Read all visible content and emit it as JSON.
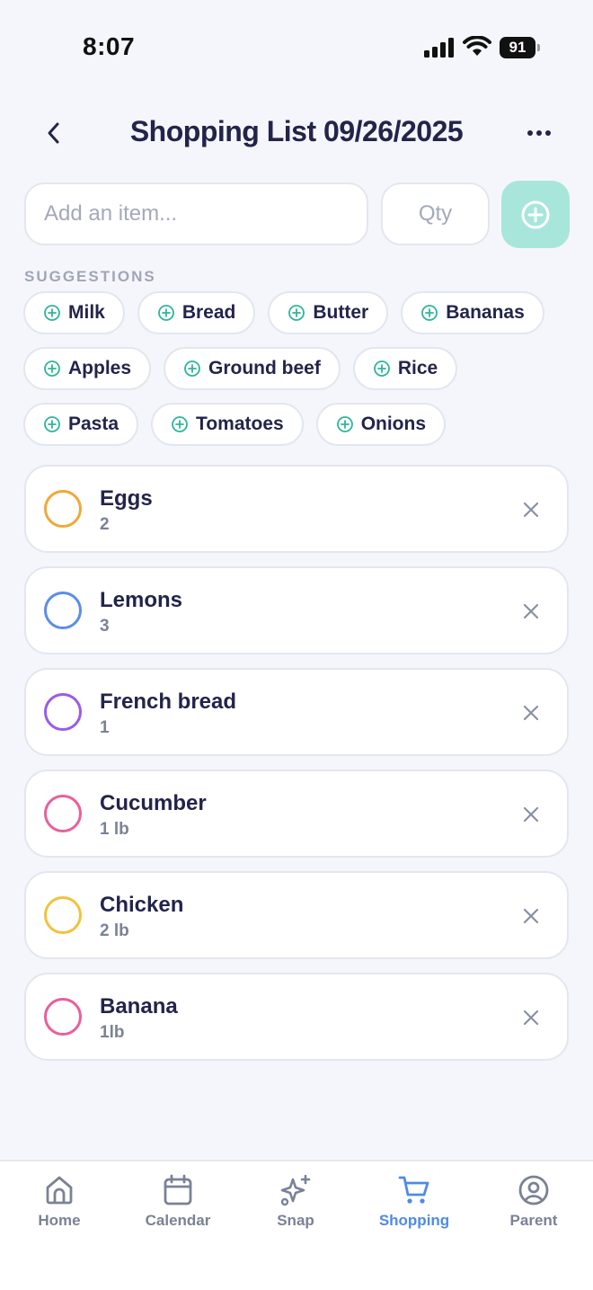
{
  "status_bar": {
    "time": "8:07",
    "battery": "91"
  },
  "header": {
    "title": "Shopping List 09/26/2025",
    "back_icon": "chevron-left-icon",
    "more_icon": "more-horizontal-icon"
  },
  "add_item": {
    "item_placeholder": "Add an item...",
    "qty_placeholder": "Qty",
    "add_icon": "plus-circle-icon"
  },
  "suggestions": {
    "label": "SUGGESTIONS",
    "items": [
      "Milk",
      "Bread",
      "Butter",
      "Bananas",
      "Apples",
      "Ground beef",
      "Rice",
      "Pasta",
      "Tomatoes",
      "Onions"
    ]
  },
  "list": {
    "items": [
      {
        "name": "Eggs",
        "qty": "2",
        "color": "#f0a83a"
      },
      {
        "name": "Lemons",
        "qty": "3",
        "color": "#5b8ee6"
      },
      {
        "name": "French bread",
        "qty": "1",
        "color": "#9b5be8"
      },
      {
        "name": "Cucumber",
        "qty": "1 lb",
        "color": "#e8609a"
      },
      {
        "name": "Chicken",
        "qty": "2 lb",
        "color": "#f2c23c"
      },
      {
        "name": "Banana",
        "qty": "1lb",
        "color": "#e8609a"
      }
    ]
  },
  "nav": {
    "items": [
      {
        "label": "Home",
        "icon": "home-icon"
      },
      {
        "label": "Calendar",
        "icon": "calendar-icon"
      },
      {
        "label": "Snap",
        "icon": "sparkles-icon"
      },
      {
        "label": "Shopping",
        "icon": "cart-icon",
        "active": true
      },
      {
        "label": "Parent",
        "icon": "user-circle-icon"
      }
    ]
  },
  "colors": {
    "accent": "#4f8ae6",
    "add_button": "#a8e6db",
    "suggestion_icon": "#2fb59a"
  }
}
